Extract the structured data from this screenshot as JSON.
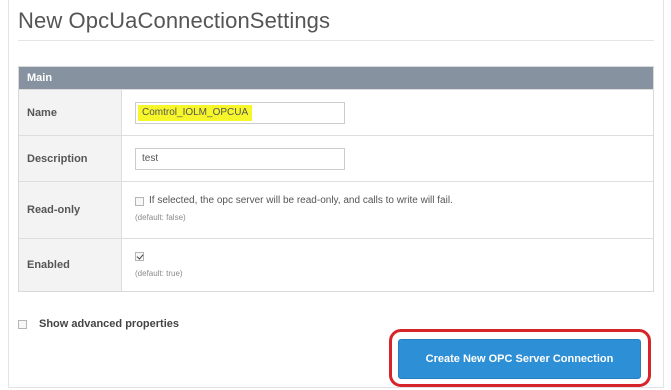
{
  "page": {
    "title": "New OpcUaConnectionSettings"
  },
  "panel": {
    "header": "Main",
    "rows": {
      "name": {
        "label": "Name",
        "value": "Comtrol_IOLM_OPCUA"
      },
      "description": {
        "label": "Description",
        "value": "test"
      },
      "readonly": {
        "label": "Read-only",
        "checked": false,
        "text": "If selected, the opc server will be read-only, and calls to write will fail.",
        "default": "(default: false)"
      },
      "enabled": {
        "label": "Enabled",
        "checked": true,
        "default": "(default: true)"
      }
    }
  },
  "advanced": {
    "label": "Show advanced properties",
    "checked": false
  },
  "actions": {
    "create_label": "Create New OPC Server Connection"
  },
  "colors": {
    "panel_header": "#8792a0",
    "highlight": "#f6f62a",
    "primary_button": "#2d8fd6",
    "callout_outline": "#d6242a"
  }
}
